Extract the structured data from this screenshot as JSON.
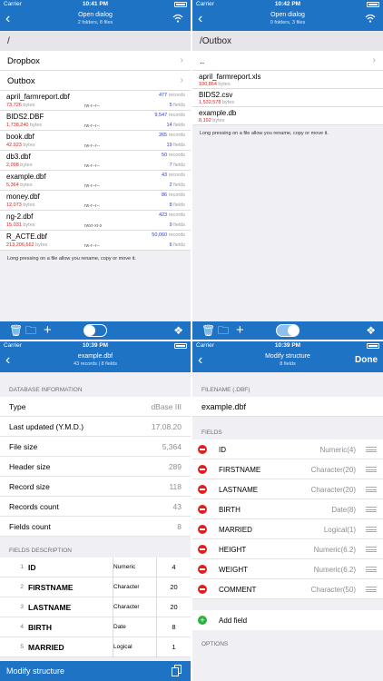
{
  "panel1": {
    "status": {
      "carrier": "Carrier",
      "time": "10:41 PM"
    },
    "title": "Open dialog",
    "subtitle": "2 folders, 8 files",
    "path": "/",
    "folders": [
      "Dropbox",
      "Outbox"
    ],
    "files": [
      {
        "name": "april_farmreport.dbf",
        "size": "73,726",
        "perm": "rw-r--r--",
        "records": "477",
        "fields": "5"
      },
      {
        "name": "BIDS2.DBF",
        "size": "1,738,240",
        "perm": "rw-r--r--",
        "records": "9,547",
        "fields": "14"
      },
      {
        "name": "book.dbf",
        "size": "42,923",
        "perm": "rw-r--r--",
        "records": "265",
        "fields": "19"
      },
      {
        "name": "db3.dbf",
        "size": "2,098",
        "perm": "rw-r--r--",
        "records": "50",
        "fields": "7"
      },
      {
        "name": "example.dbf",
        "size": "5,364",
        "perm": "rw-r--r--",
        "records": "43",
        "fields": "2"
      },
      {
        "name": "money.dbf",
        "size": "12,073",
        "perm": "rw-r--r--",
        "records": "86",
        "fields": "8"
      },
      {
        "name": "ng-2.dbf",
        "size": "15,031",
        "perm": "rwxr-xr-x",
        "records": "423",
        "fields": "9"
      },
      {
        "name": "R_ACTE.dbf",
        "size": "213,206,662",
        "perm": "rw-r--r--",
        "records": "50,060",
        "fields": "6"
      }
    ],
    "hint": "Long pressing on a file allow you rename, copy or move it.",
    "toggle_on": false
  },
  "panel2": {
    "status": {
      "carrier": "Carrier",
      "time": "10:42 PM"
    },
    "title": "Open dialog",
    "subtitle": "0 folders, 3 files",
    "path": "/Outbox",
    "parent": "..",
    "files": [
      {
        "name": "april_farmreport.xls",
        "size": "100,864"
      },
      {
        "name": "BIDS2.csv",
        "size": "1,532,578"
      },
      {
        "name": "example.db",
        "size": "8,192"
      }
    ],
    "hint": "Long pressing on a file allow you rename, copy or move it.",
    "toggle_on": true
  },
  "panel3": {
    "status": {
      "carrier": "Carrier",
      "time": "10:39 PM"
    },
    "title": "example.dbf",
    "subtitle": "43 records | 8 fields",
    "info_section": "DATABASE INFORMATION",
    "info": [
      {
        "label": "Type",
        "value": "dBase III"
      },
      {
        "label": "Last updated (Y.M.D.)",
        "value": "17.08.20"
      },
      {
        "label": "File size",
        "value": "5,364"
      },
      {
        "label": "Header size",
        "value": "289"
      },
      {
        "label": "Record size",
        "value": "118"
      },
      {
        "label": "Records count",
        "value": "43"
      },
      {
        "label": "Fields count",
        "value": "8"
      }
    ],
    "fields_section": "FIELDS DESCRIPTION",
    "fields": [
      {
        "no": "1",
        "name": "ID",
        "type": "Numeric",
        "size": "4"
      },
      {
        "no": "2",
        "name": "FIRSTNAME",
        "type": "Character",
        "size": "20"
      },
      {
        "no": "3",
        "name": "LASTNAME",
        "type": "Character",
        "size": "20"
      },
      {
        "no": "4",
        "name": "BIRTH",
        "type": "Date",
        "size": "8"
      },
      {
        "no": "5",
        "name": "MARRIED",
        "type": "Logical",
        "size": "1"
      }
    ],
    "bottom_label": "Modify structure"
  },
  "panel4": {
    "status": {
      "carrier": "Carrier",
      "time": "10:39 PM"
    },
    "title": "Modify structure",
    "subtitle": "8 fields",
    "done": "Done",
    "filename_section": "FILENAME (.DBF)",
    "filename": "example.dbf",
    "fields_section": "FIELDS",
    "fields": [
      {
        "name": "ID",
        "type": "Numeric(4)"
      },
      {
        "name": "FIRSTNAME",
        "type": "Character(20)"
      },
      {
        "name": "LASTNAME",
        "type": "Character(20)"
      },
      {
        "name": "BIRTH",
        "type": "Date(8)"
      },
      {
        "name": "MARRIED",
        "type": "Logical(1)"
      },
      {
        "name": "HEIGHT",
        "type": "Numeric(6.2)"
      },
      {
        "name": "WEIGHT",
        "type": "Numeric(6.2)"
      },
      {
        "name": "COMMENT",
        "type": "Character(50)"
      }
    ],
    "add_field": "Add field",
    "options_section": "OPTIONS"
  },
  "units": {
    "bytes": "bytes",
    "records": "records",
    "fields": "fields"
  },
  "colors": {
    "accent": "#1f73c5",
    "size_red": "#e0201b",
    "count_blue": "#2f3bd6",
    "delete_red": "#e0201b",
    "add_green": "#27b33e"
  }
}
